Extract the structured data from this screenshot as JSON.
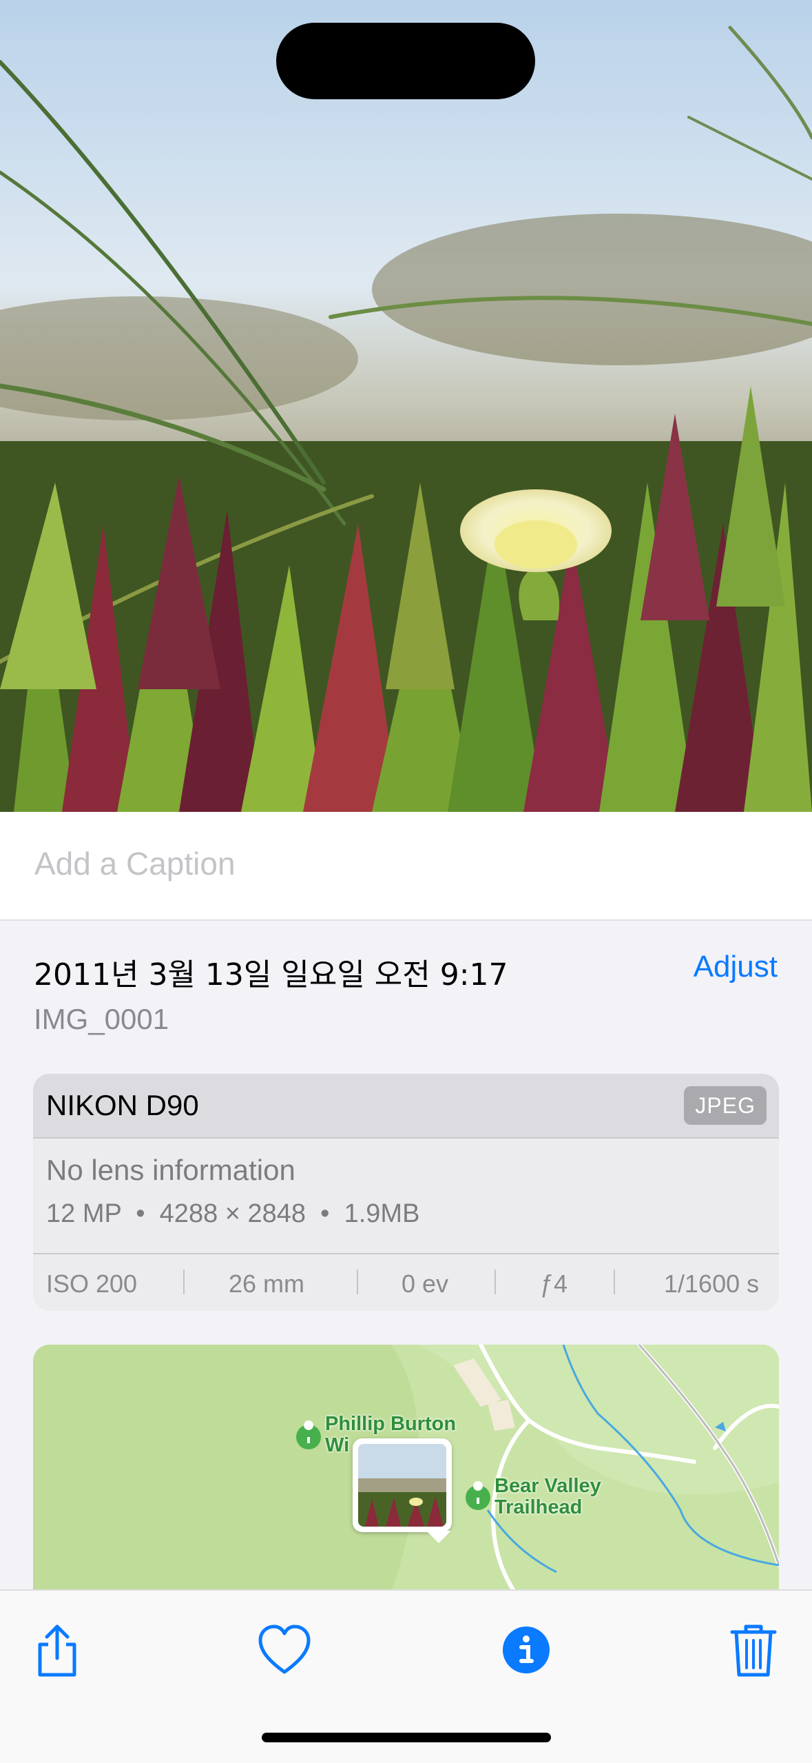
{
  "photo": {
    "description_icon": "photo-image"
  },
  "caption": {
    "placeholder": "Add a Caption"
  },
  "info": {
    "date": "2011년 3월 13일 일요일 오전 9:17",
    "adjust_label": "Adjust",
    "filename": "IMG_0001"
  },
  "metadata": {
    "camera": "NIKON D90",
    "format": "JPEG",
    "lens": "No lens information",
    "specs": "12 MP  •  4288 × 2848  •  1.9MB",
    "stats": {
      "iso": "ISO 200",
      "focal": "26 mm",
      "ev": "0 ev",
      "aperture": "ƒ4",
      "shutter": "1/1600 s"
    }
  },
  "map": {
    "label1_line1": "Phillip Burton",
    "label1_line2": "Wi",
    "label2_line1": "Bear Valley",
    "label2_line2": "Trailhead"
  },
  "toolbar": {
    "share": "share-icon",
    "favorite": "heart-icon",
    "info": "info-icon",
    "delete": "trash-icon"
  },
  "colors": {
    "accent": "#0a7aff",
    "background": "#f2f2f7"
  }
}
